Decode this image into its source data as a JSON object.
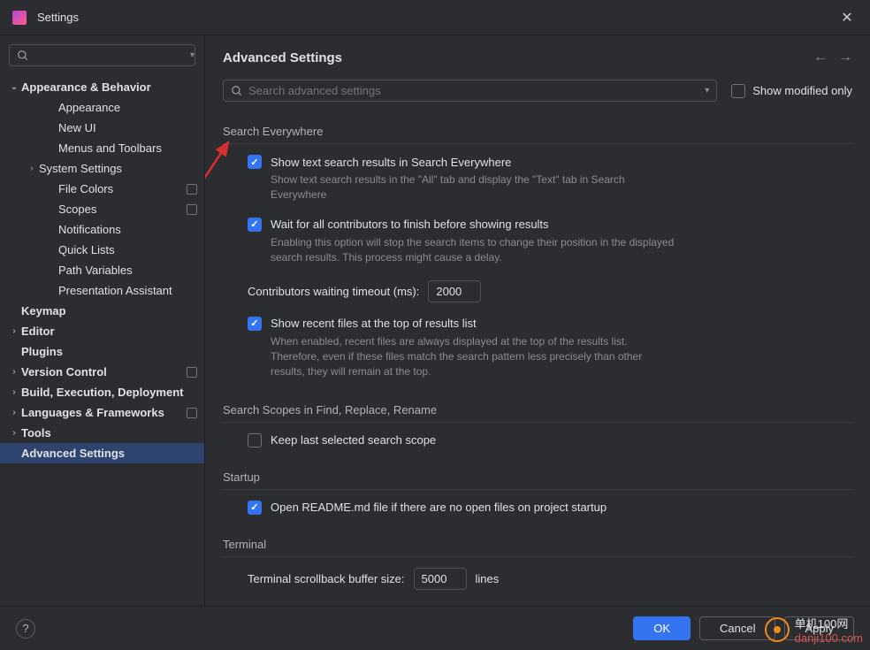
{
  "window": {
    "title": "Settings"
  },
  "sidebar": {
    "search_placeholder": "",
    "items": [
      {
        "label": "Appearance & Behavior",
        "indent": 0,
        "bold": true,
        "chevron": "down"
      },
      {
        "label": "Appearance",
        "indent": 2
      },
      {
        "label": "New UI",
        "indent": 2
      },
      {
        "label": "Menus and Toolbars",
        "indent": 2
      },
      {
        "label": "System Settings",
        "indent": 1,
        "chevron": "right"
      },
      {
        "label": "File Colors",
        "indent": 2,
        "badge": true
      },
      {
        "label": "Scopes",
        "indent": 2,
        "badge": true
      },
      {
        "label": "Notifications",
        "indent": 2
      },
      {
        "label": "Quick Lists",
        "indent": 2
      },
      {
        "label": "Path Variables",
        "indent": 2
      },
      {
        "label": "Presentation Assistant",
        "indent": 2
      },
      {
        "label": "Keymap",
        "indent": 0,
        "bold": true,
        "nochev": true
      },
      {
        "label": "Editor",
        "indent": 0,
        "bold": true,
        "chevron": "right"
      },
      {
        "label": "Plugins",
        "indent": 0,
        "bold": true,
        "nochev": true
      },
      {
        "label": "Version Control",
        "indent": 0,
        "bold": true,
        "chevron": "right",
        "badge": true
      },
      {
        "label": "Build, Execution, Deployment",
        "indent": 0,
        "bold": true,
        "chevron": "right"
      },
      {
        "label": "Languages & Frameworks",
        "indent": 0,
        "bold": true,
        "chevron": "right",
        "badge": true
      },
      {
        "label": "Tools",
        "indent": 0,
        "bold": true,
        "chevron": "right"
      },
      {
        "label": "Advanced Settings",
        "indent": 0,
        "bold": true,
        "nochev": true,
        "selected": true
      }
    ]
  },
  "content": {
    "title": "Advanced Settings",
    "search_placeholder": "Search advanced settings",
    "show_modified_label": "Show modified only",
    "sections": {
      "search_everywhere": {
        "header": "Search Everywhere",
        "opt1_label": "Show text search results in Search Everywhere",
        "opt1_desc": "Show text search results in the \"All\" tab and display the \"Text\" tab in Search Everywhere",
        "opt2_label": "Wait for all contributors to finish before showing results",
        "opt2_desc": "Enabling this option will stop the search items to change their position in the displayed search results. This process might cause a delay.",
        "timeout_label": "Contributors waiting timeout (ms):",
        "timeout_value": "2000",
        "opt3_label": "Show recent files at the top of results list",
        "opt3_desc": "When enabled, recent files are always displayed at the top of the results list. Therefore, even if these files match the search pattern less precisely than other results, they will remain at the top."
      },
      "search_scopes": {
        "header": "Search Scopes in Find, Replace, Rename",
        "opt1_label": "Keep last selected search scope"
      },
      "startup": {
        "header": "Startup",
        "opt1_label": "Open README.md file if there are no open files on project startup"
      },
      "terminal": {
        "header": "Terminal",
        "buffer_label": "Terminal scrollback buffer size:",
        "buffer_value": "5000",
        "buffer_unit": "lines"
      }
    }
  },
  "footer": {
    "ok": "OK",
    "cancel": "Cancel",
    "apply": "Apply"
  },
  "watermark": {
    "cn": "单机100网",
    "dom": "danji100.com"
  }
}
